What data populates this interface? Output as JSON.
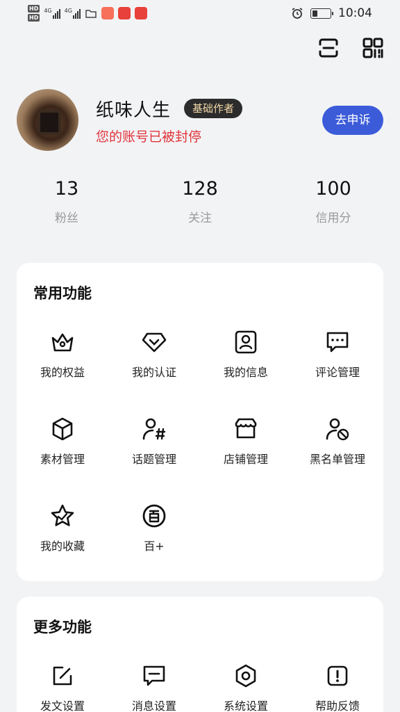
{
  "status_bar": {
    "hd1": "HD",
    "hd2": "HD",
    "net1": "4G",
    "net2": "4G",
    "time": "10:04",
    "battery_level": 0.3,
    "app_badge_colors": [
      "#f7705a",
      "#e8403a",
      "#e8403a"
    ]
  },
  "header": {
    "scan_icon": "scan-icon",
    "qr_icon": "qrcode-icon"
  },
  "profile": {
    "username": "纸味人生",
    "badge": "基础作者",
    "status": "您的账号已被封停",
    "appeal_button": "去申诉"
  },
  "stats": [
    {
      "value": "13",
      "label": "粉丝"
    },
    {
      "value": "128",
      "label": "关注"
    },
    {
      "value": "100",
      "label": "信用分"
    }
  ],
  "common": {
    "title": "常用功能",
    "items": [
      {
        "label": "我的权益",
        "icon": "crown-icon"
      },
      {
        "label": "我的认证",
        "icon": "verified-icon"
      },
      {
        "label": "我的信息",
        "icon": "profile-card-icon"
      },
      {
        "label": "评论管理",
        "icon": "comment-icon"
      },
      {
        "label": "素材管理",
        "icon": "cube-icon"
      },
      {
        "label": "话题管理",
        "icon": "topic-icon"
      },
      {
        "label": "店铺管理",
        "icon": "store-icon"
      },
      {
        "label": "黑名单管理",
        "icon": "block-user-icon"
      },
      {
        "label": "我的收藏",
        "icon": "star-icon"
      },
      {
        "label": "百+",
        "icon": "bai-icon"
      }
    ]
  },
  "more": {
    "title": "更多功能",
    "items": [
      {
        "label": "发文设置",
        "icon": "edit-icon"
      },
      {
        "label": "消息设置",
        "icon": "message-icon"
      },
      {
        "label": "系统设置",
        "icon": "settings-icon"
      },
      {
        "label": "帮助反馈",
        "icon": "help-icon"
      }
    ]
  },
  "colors": {
    "accent": "#3b5bd9",
    "danger": "#e0343b",
    "badge_bg": "#2c2c2c",
    "badge_text": "#f3d9a8",
    "page_bg": "#f2f3f5"
  }
}
